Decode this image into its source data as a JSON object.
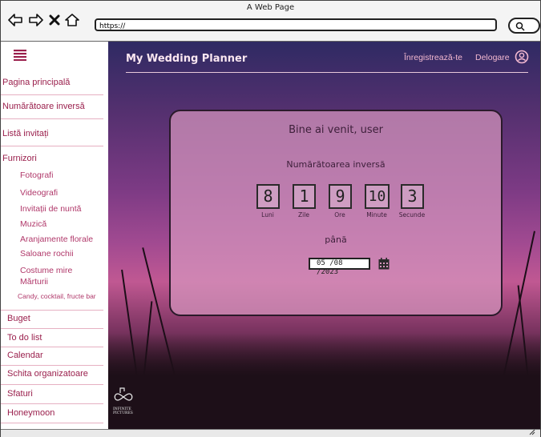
{
  "window": {
    "title": "A Web Page"
  },
  "browser": {
    "url": "https://"
  },
  "sidebar": {
    "items": [
      {
        "label": "Pagina principală"
      },
      {
        "label": "Numărătoare inversă"
      },
      {
        "label": "Listă invitați"
      },
      {
        "label": "Furnizori"
      }
    ],
    "subitems": [
      {
        "label": "Fotografi"
      },
      {
        "label": "Videografi"
      },
      {
        "label": "Invitații de nuntă"
      },
      {
        "label": "Muzică"
      },
      {
        "label": "Aranjamente florale"
      },
      {
        "label": "Saloane rochii"
      },
      {
        "label": "Costume mire"
      },
      {
        "label": "Mărturii"
      },
      {
        "label": "Candy, cocktail, fructe bar"
      }
    ],
    "bottom_items": [
      {
        "label": "Buget"
      },
      {
        "label": "To do list"
      },
      {
        "label": "Calendar"
      },
      {
        "label": "Schita organizatoare"
      },
      {
        "label": "Sfaturi"
      },
      {
        "label": "Honeymoon"
      }
    ]
  },
  "header": {
    "brand": "My Wedding Planner",
    "register": "Înregistrează-te",
    "logout": "Delogare"
  },
  "card": {
    "welcome": "Bine ai venit, user",
    "countdown_title": "Numărătoarea inversă",
    "until": "până",
    "date_value": "05 /08 /2023",
    "units": [
      {
        "value": "8",
        "label": "Luni"
      },
      {
        "value": "1",
        "label": "Zile"
      },
      {
        "value": "9",
        "label": "Ore"
      },
      {
        "value": "10",
        "label": "Minute"
      },
      {
        "value": "3",
        "label": "Secunde"
      }
    ]
  },
  "footer_logo": {
    "line1": "INFINITE",
    "line2": "PICTURES"
  },
  "colors": {
    "accent": "#9a1f4c",
    "card": "#d696be",
    "brand_text": "#fbe7f1"
  }
}
